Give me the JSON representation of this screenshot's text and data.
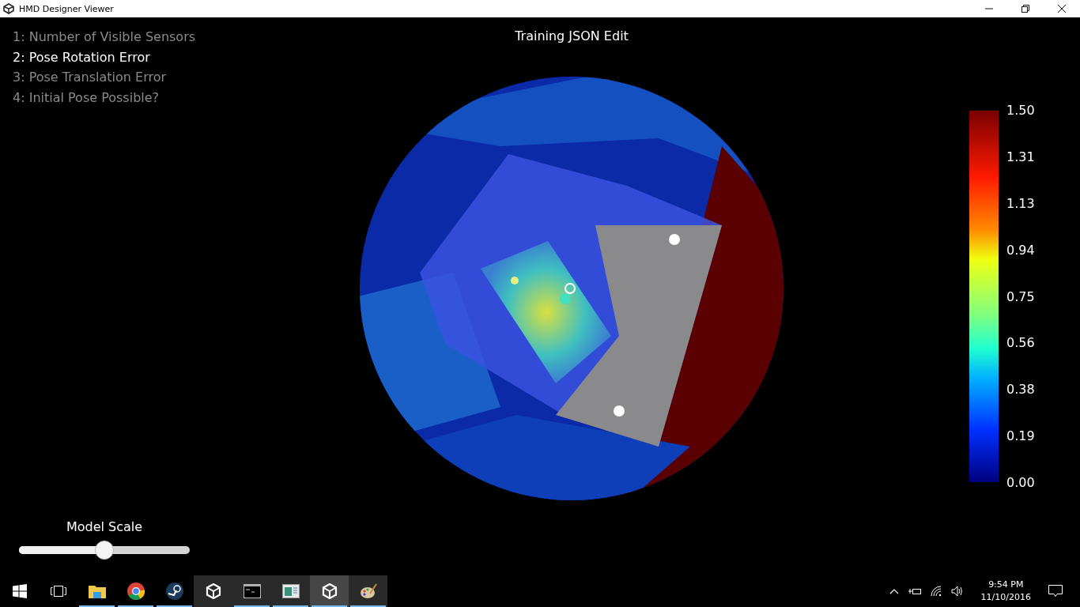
{
  "window": {
    "title": "HMD Designer Viewer"
  },
  "view_title": "Training JSON Edit",
  "modes": [
    {
      "label": "1: Number of Visible Sensors",
      "selected": false
    },
    {
      "label": "2: Pose Rotation Error",
      "selected": true
    },
    {
      "label": "3: Pose Translation Error",
      "selected": false
    },
    {
      "label": "4: Initial Pose Possible?",
      "selected": false
    }
  ],
  "legend": {
    "labels": [
      "1.50",
      "1.31",
      "1.13",
      "0.94",
      "0.75",
      "0.56",
      "0.38",
      "0.19",
      "0.00"
    ]
  },
  "model_scale": {
    "label": "Model Scale",
    "level": 0.5
  },
  "taskbar": {
    "apps": [
      {
        "kind": "start",
        "running": false,
        "selected": false
      },
      {
        "kind": "taskview",
        "running": false,
        "selected": false
      },
      {
        "kind": "folder",
        "running": true,
        "selected": false
      },
      {
        "kind": "browser",
        "running": true,
        "selected": false
      },
      {
        "kind": "steam",
        "running": true,
        "selected": false
      },
      {
        "kind": "unity",
        "running": false,
        "selected": false
      },
      {
        "kind": "terminal",
        "running": true,
        "selected": false
      },
      {
        "kind": "window",
        "running": true,
        "selected": false
      },
      {
        "kind": "unity",
        "running": true,
        "selected": true
      },
      {
        "kind": "paint",
        "running": true,
        "selected": false
      }
    ],
    "time": "9:54 PM",
    "date": "11/10/2016"
  }
}
